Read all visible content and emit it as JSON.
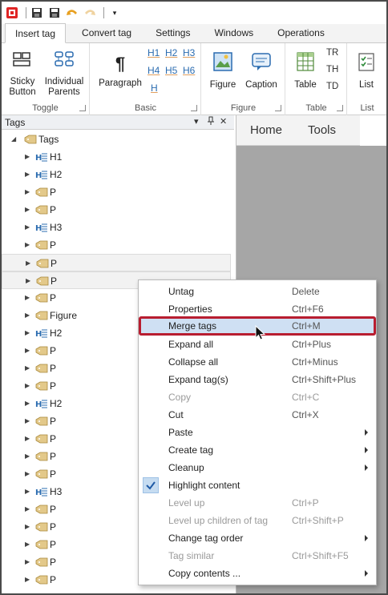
{
  "tabs": [
    {
      "label": "Insert tag"
    },
    {
      "label": "Convert tag"
    },
    {
      "label": "Settings"
    },
    {
      "label": "Windows"
    },
    {
      "label": "Operations"
    }
  ],
  "ribbon": {
    "toggle": {
      "sticky_line1": "Sticky",
      "sticky_line2": "Button",
      "individual_line1": "Individual",
      "individual_line2": "Parents",
      "group_label": "Toggle"
    },
    "basic": {
      "paragraph": "Paragraph",
      "h1": "H1",
      "h2": "H2",
      "h3": "H3",
      "h4": "H4",
      "h5": "H5",
      "h6": "H6",
      "h": "H",
      "group_label": "Basic"
    },
    "figure": {
      "figure": "Figure",
      "caption": "Caption",
      "group_label": "Figure"
    },
    "table": {
      "table": "Table",
      "tr": "TR",
      "th": "TH",
      "td": "TD",
      "group_label": "Table"
    },
    "list": {
      "list": "List",
      "group_label": "List"
    }
  },
  "panel": {
    "title": "Tags",
    "pin": "░",
    "close": "✕"
  },
  "tree": {
    "root": "Tags",
    "items": [
      {
        "label": "H1",
        "icon": "heading"
      },
      {
        "label": "H2",
        "icon": "heading"
      },
      {
        "label": "P",
        "icon": "tag"
      },
      {
        "label": "P",
        "icon": "tag"
      },
      {
        "label": "H3",
        "icon": "heading"
      },
      {
        "label": "P",
        "icon": "tag"
      },
      {
        "label": "P",
        "icon": "tag"
      },
      {
        "label": "P",
        "icon": "tag"
      },
      {
        "label": "P",
        "icon": "tag"
      },
      {
        "label": "Figure",
        "icon": "tag"
      },
      {
        "label": "H2",
        "icon": "heading"
      },
      {
        "label": "P",
        "icon": "tag"
      },
      {
        "label": "P",
        "icon": "tag"
      },
      {
        "label": "P",
        "icon": "tag"
      },
      {
        "label": "H2",
        "icon": "heading"
      },
      {
        "label": "P",
        "icon": "tag"
      },
      {
        "label": "P",
        "icon": "tag"
      },
      {
        "label": "P",
        "icon": "tag"
      },
      {
        "label": "P",
        "icon": "tag"
      },
      {
        "label": "H3",
        "icon": "heading"
      },
      {
        "label": "P",
        "icon": "tag"
      },
      {
        "label": "P",
        "icon": "tag"
      },
      {
        "label": "P",
        "icon": "tag"
      },
      {
        "label": "P",
        "icon": "tag"
      },
      {
        "label": "P",
        "icon": "tag"
      }
    ]
  },
  "document": {
    "tab_home": "Home",
    "tab_tools": "Tools"
  },
  "menu": {
    "items": [
      {
        "label": "Untag",
        "shortcut": "Delete"
      },
      {
        "label": "Properties",
        "shortcut": "Ctrl+F6"
      },
      {
        "label": "Merge tags",
        "shortcut": "Ctrl+M"
      },
      {
        "label": "Expand all",
        "shortcut": "Ctrl+Plus"
      },
      {
        "label": "Collapse all",
        "shortcut": "Ctrl+Minus"
      },
      {
        "label": "Expand tag(s)",
        "shortcut": "Ctrl+Shift+Plus"
      },
      {
        "label": "Copy",
        "shortcut": "Ctrl+C"
      },
      {
        "label": "Cut",
        "shortcut": "Ctrl+X"
      },
      {
        "label": "Paste",
        "shortcut": ""
      },
      {
        "label": "Create tag",
        "shortcut": ""
      },
      {
        "label": "Cleanup",
        "shortcut": ""
      },
      {
        "label": "Highlight content",
        "shortcut": ""
      },
      {
        "label": "Level up",
        "shortcut": "Ctrl+P"
      },
      {
        "label": "Level up children of tag",
        "shortcut": "Ctrl+Shift+P"
      },
      {
        "label": "Change tag order",
        "shortcut": ""
      },
      {
        "label": "Tag similar",
        "shortcut": "Ctrl+Shift+F5"
      },
      {
        "label": "Copy contents ...",
        "shortcut": ""
      }
    ]
  },
  "colors": {
    "accent_blue": "#2b6cb0",
    "highlight_border": "#b81d30",
    "menu_highlight": "#d3e2f3"
  }
}
